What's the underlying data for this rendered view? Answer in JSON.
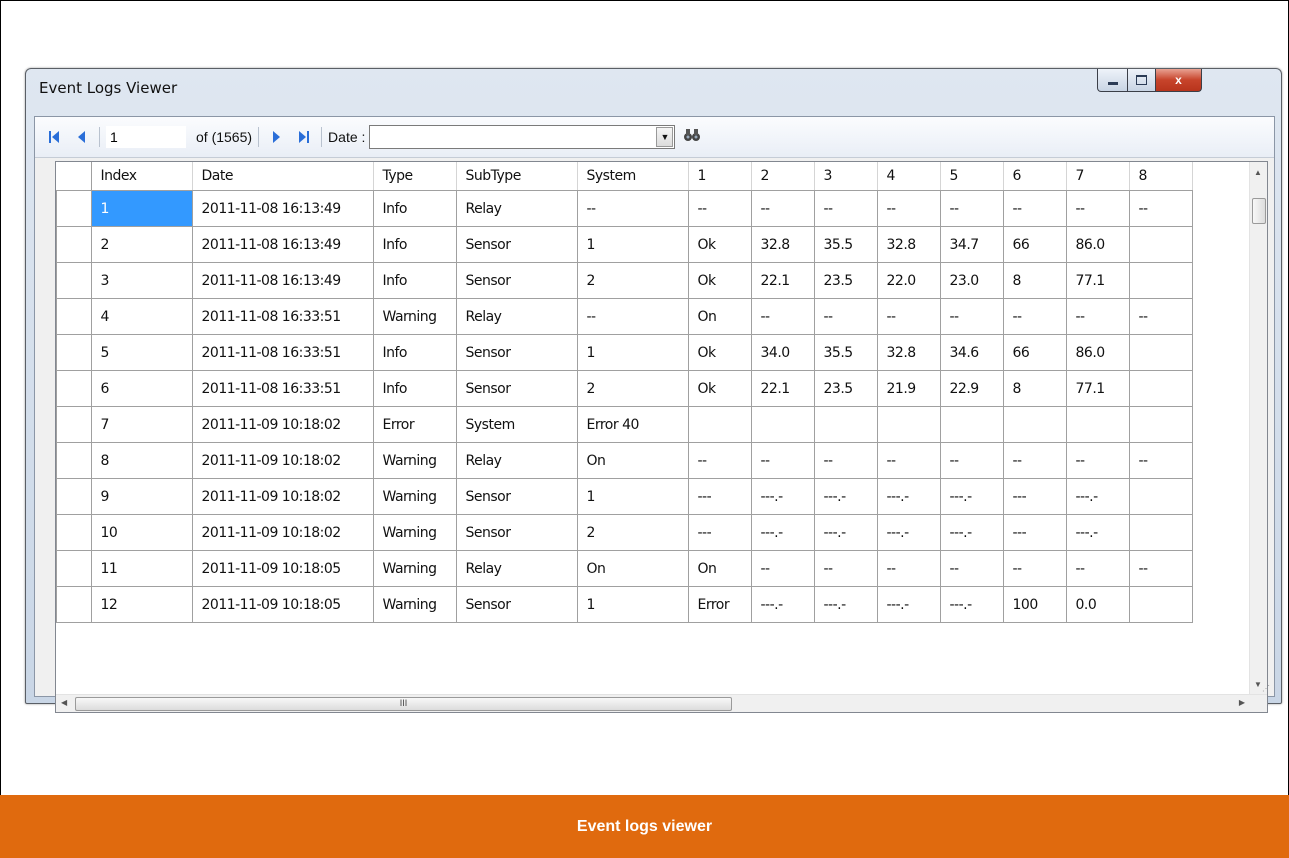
{
  "window": {
    "title": "Event Logs Viewer",
    "close_glyph": "x"
  },
  "toolbar": {
    "position_value": "1",
    "of_label": "of (1565)",
    "date_label": "Date :",
    "date_value": "",
    "icons": [
      "first-page-icon",
      "prev-page-icon",
      "next-page-icon",
      "last-page-icon",
      "dropdown-arrow-icon",
      "binoculars-search-icon"
    ]
  },
  "grid": {
    "columns": [
      "Index",
      "Date",
      "Type",
      "SubType",
      "System",
      "1",
      "2",
      "3",
      "4",
      "5",
      "6",
      "7",
      "8"
    ],
    "rows": [
      [
        "1",
        "2011-11-08 16:13:49",
        "Info",
        "Relay",
        "--",
        "--",
        "--",
        "--",
        "--",
        "--",
        "--",
        "--",
        "--"
      ],
      [
        "2",
        "2011-11-08 16:13:49",
        "Info",
        "Sensor",
        "1",
        "Ok",
        "32.8",
        "35.5",
        "32.8",
        "34.7",
        "66",
        "86.0",
        ""
      ],
      [
        "3",
        "2011-11-08 16:13:49",
        "Info",
        "Sensor",
        "2",
        "Ok",
        "22.1",
        "23.5",
        "22.0",
        "23.0",
        "8",
        "77.1",
        ""
      ],
      [
        "4",
        "2011-11-08 16:33:51",
        "Warning",
        "Relay",
        "--",
        "On",
        "--",
        "--",
        "--",
        "--",
        "--",
        "--",
        "--"
      ],
      [
        "5",
        "2011-11-08 16:33:51",
        "Info",
        "Sensor",
        "1",
        "Ok",
        "34.0",
        "35.5",
        "32.8",
        "34.6",
        "66",
        "86.0",
        ""
      ],
      [
        "6",
        "2011-11-08 16:33:51",
        "Info",
        "Sensor",
        "2",
        "Ok",
        "22.1",
        "23.5",
        "21.9",
        "22.9",
        "8",
        "77.1",
        ""
      ],
      [
        "7",
        "2011-11-09 10:18:02",
        "Error",
        "System",
        "Error 40",
        "",
        "",
        "",
        "",
        "",
        "",
        "",
        ""
      ],
      [
        "8",
        "2011-11-09 10:18:02",
        "Warning",
        "Relay",
        "On",
        "--",
        "--",
        "--",
        "--",
        "--",
        "--",
        "--",
        "--"
      ],
      [
        "9",
        "2011-11-09 10:18:02",
        "Warning",
        "Sensor",
        "1",
        "---",
        "---.-",
        "---.-",
        "---.-",
        "---.-",
        "---",
        "---.-",
        ""
      ],
      [
        "10",
        "2011-11-09 10:18:02",
        "Warning",
        "Sensor",
        "2",
        "---",
        "---.-",
        "---.-",
        "---.-",
        "---.-",
        "---",
        "---.-",
        ""
      ],
      [
        "11",
        "2011-11-09 10:18:05",
        "Warning",
        "Relay",
        "On",
        "On",
        "--",
        "--",
        "--",
        "--",
        "--",
        "--",
        "--"
      ],
      [
        "12",
        "2011-11-09 10:18:05",
        "Warning",
        "Sensor",
        "1",
        "Error",
        "---.-",
        "---.-",
        "---.-",
        "---.-",
        "100",
        "0.0",
        ""
      ]
    ],
    "selected_row": 1,
    "hscroll_grip": "III"
  },
  "caption": "Event logs viewer"
}
